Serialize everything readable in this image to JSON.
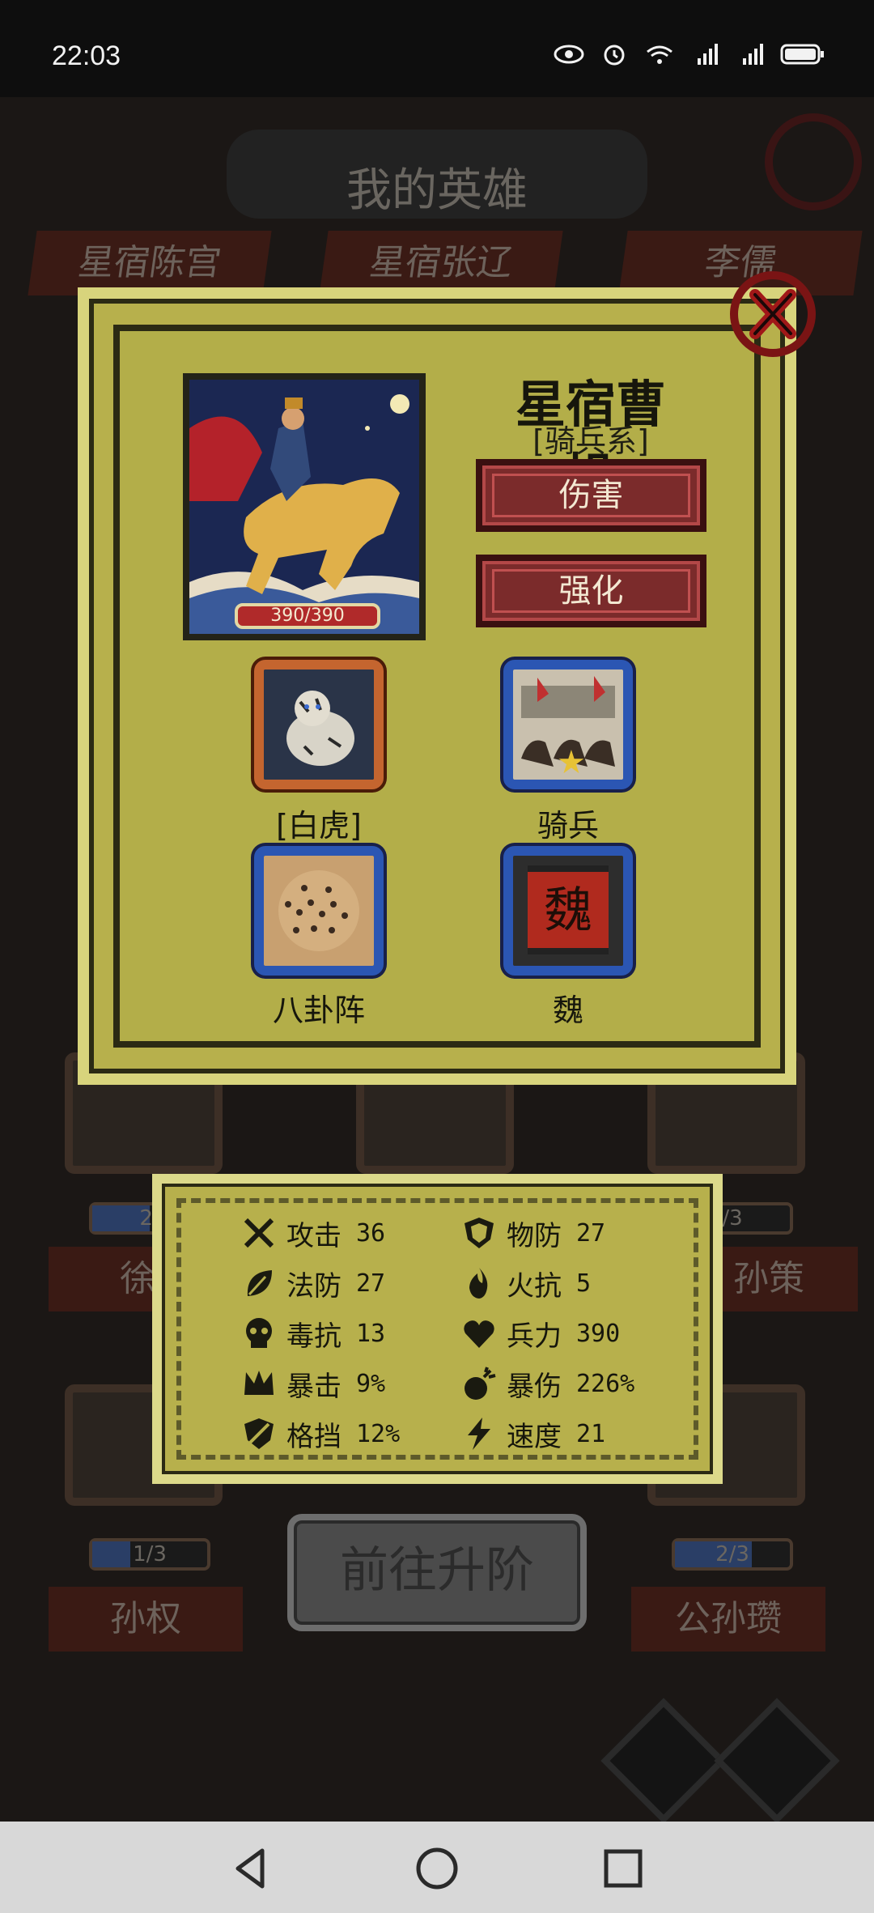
{
  "status_bar": {
    "time": "22:03"
  },
  "background": {
    "title": "我的英雄",
    "tabs": [
      "星宿陈宫",
      "星宿张辽",
      "李儒"
    ],
    "progress": [
      {
        "label": "2/",
        "fraction": 0.5
      },
      {
        "label": "/3",
        "fraction": 0.0
      },
      {
        "label": "1/3",
        "fraction": 0.33
      },
      {
        "label": "2/3",
        "fraction": 0.67
      }
    ],
    "names": [
      "徐",
      "孙策",
      "孙权",
      "公孙瓒"
    ]
  },
  "hero": {
    "name": "星宿曹操",
    "class": "[骑兵系]",
    "hp": "390/390",
    "buttons": {
      "damage": "伤害",
      "enhance": "强化"
    },
    "skills": [
      {
        "label": "[白虎]",
        "icon": "white-tiger-icon"
      },
      {
        "label": "骑兵",
        "icon": "cavalry-icon"
      },
      {
        "label": "八卦阵",
        "icon": "bagua-formation-icon"
      },
      {
        "label": "魏",
        "icon": "wei-banner-icon",
        "banner_text": "魏"
      }
    ]
  },
  "stats": [
    {
      "label": "攻击",
      "value": "36",
      "icon": "swords-icon"
    },
    {
      "label": "物防",
      "value": "27",
      "icon": "shield-icon"
    },
    {
      "label": "法防",
      "value": "27",
      "icon": "leaf-icon"
    },
    {
      "label": "火抗",
      "value": "5",
      "icon": "fire-icon"
    },
    {
      "label": "毒抗",
      "value": "13",
      "icon": "skull-icon"
    },
    {
      "label": "兵力",
      "value": "390",
      "icon": "heart-icon"
    },
    {
      "label": "暴击",
      "value": "9%",
      "icon": "crown-icon"
    },
    {
      "label": "暴伤",
      "value": "226%",
      "icon": "bomb-icon"
    },
    {
      "label": "格挡",
      "value": "12%",
      "icon": "block-shield-icon"
    },
    {
      "label": "速度",
      "value": "21",
      "icon": "lightning-icon"
    }
  ],
  "upgrade_button": "前往升阶",
  "colors": {
    "panel": "#b7b04c",
    "button_red": "#7b2b2b",
    "skill_blue": "#2b56b3",
    "skill_orange": "#c4652f"
  }
}
